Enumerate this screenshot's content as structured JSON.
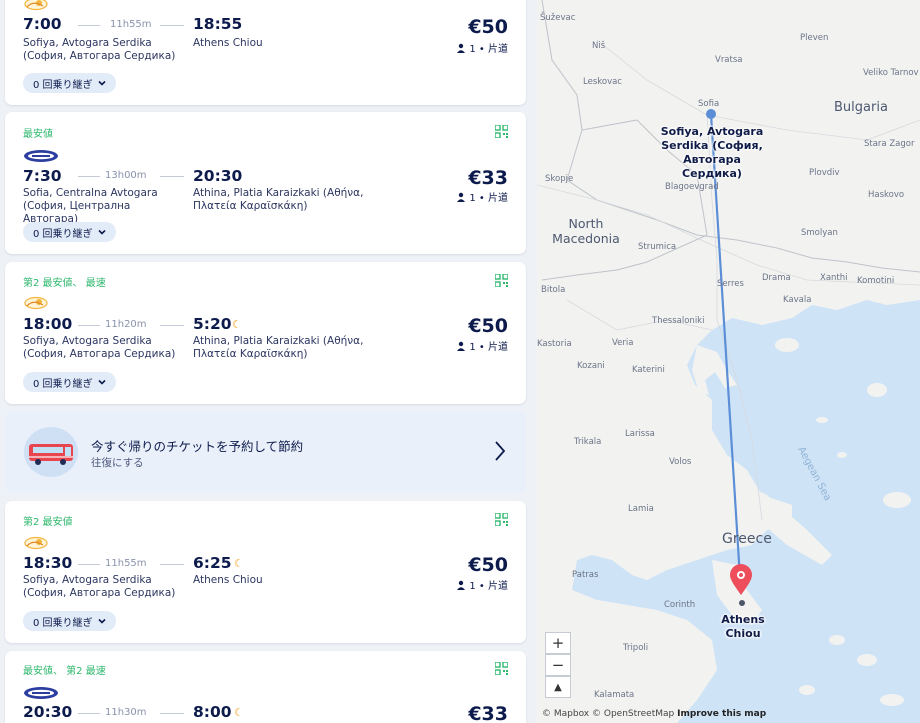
{
  "results": [
    {
      "tag": "",
      "carrier_logo": "flixbus-like-orange-logo",
      "dep_time": "7:00",
      "duration": "11h55m",
      "arr_time": "18:55",
      "overnight": false,
      "dep_station": "Sofiya, Avtogara Serdika (София, Автогара Сердика)",
      "arr_station": "Athens Chiou",
      "price": "€50",
      "pax": "1 • 片道",
      "transfers": "0 回乗り継ぎ",
      "qr": false
    },
    {
      "tag": "最安値",
      "carrier_logo": "blue-oval-logo",
      "dep_time": "7:30",
      "duration": "13h00m",
      "arr_time": "20:30",
      "overnight": false,
      "dep_station": "Sofia, Centralna Avtogara (София, Централна Автогара)",
      "arr_station": "Athina, Platia Karaizkaki (Αθήνα, Πλατεία Καραϊσκάκη)",
      "price": "€33",
      "pax": "1 • 片道",
      "transfers": "0 回乗り継ぎ",
      "qr": true
    },
    {
      "tag": "第2 最安値、 最速",
      "carrier_logo": "flixbus-like-orange-logo",
      "dep_time": "18:00",
      "duration": "11h20m",
      "arr_time": "5:20",
      "overnight": true,
      "dep_station": "Sofiya, Avtogara Serdika (София, Автогара Сердика)",
      "arr_station": "Athina, Platia Karaizkaki (Αθήνα, Πλατεία Καραϊσκάκη)",
      "price": "€50",
      "pax": "1 • 片道",
      "transfers": "0 回乗り継ぎ",
      "qr": true
    },
    {
      "tag": "第2 最安値",
      "carrier_logo": "flixbus-like-orange-logo",
      "dep_time": "18:30",
      "duration": "11h55m",
      "arr_time": "6:25",
      "overnight": true,
      "dep_station": "Sofiya, Avtogara Serdika (София, Автогара Сердика)",
      "arr_station": "Athens Chiou",
      "price": "€50",
      "pax": "1 • 片道",
      "transfers": "0 回乗り継ぎ",
      "qr": true
    },
    {
      "tag": "最安値、 第2 最速",
      "carrier_logo": "blue-oval-logo",
      "dep_time": "20:30",
      "duration": "11h30m",
      "arr_time": "8:00",
      "overnight": true,
      "dep_station": "",
      "arr_station": "",
      "price": "€33",
      "pax": "",
      "transfers": "",
      "qr": true
    }
  ],
  "promo": {
    "title": "今すぐ帰りのチケットを予約して節約",
    "subtitle": "往復にする",
    "icon": "bus-icon"
  },
  "map": {
    "labels": [
      "Šuževac",
      "Niš",
      "Pleven",
      "Vratsa",
      "Veliko Tarnov",
      "Leskovac",
      "Sofia",
      "Bulgaria",
      "Stara Zagor",
      "Plovdiv",
      "Skopje",
      "Blagoevgrad",
      "Haskovo",
      "North Macedonia",
      "Strumica",
      "Smolyan",
      "Bitola",
      "Serres",
      "Drama",
      "Xanthi",
      "Komotini",
      "Kavala",
      "Thessaloniki",
      "Kastoria",
      "Veria",
      "Kozani",
      "Katerini",
      "Trikala",
      "Larissa",
      "Volos",
      "Lamia",
      "Greece",
      "Patras",
      "Corinth",
      "Tripoli",
      "Kalamata",
      "Aegean Sea"
    ],
    "origin_label": "Sofiya, Avtogara Serdika (София, Автогара Сердика)",
    "destination_label": "Athens Chiou",
    "route_color": "#5b8ed6",
    "pin_color": "#ee4e5c",
    "zoom_in": "+",
    "zoom_out": "−",
    "compass": "▲",
    "attribution_mapbox": "© Mapbox",
    "attribution_osm": "© OpenStreetMap",
    "attribution_improve": "Improve this map"
  }
}
